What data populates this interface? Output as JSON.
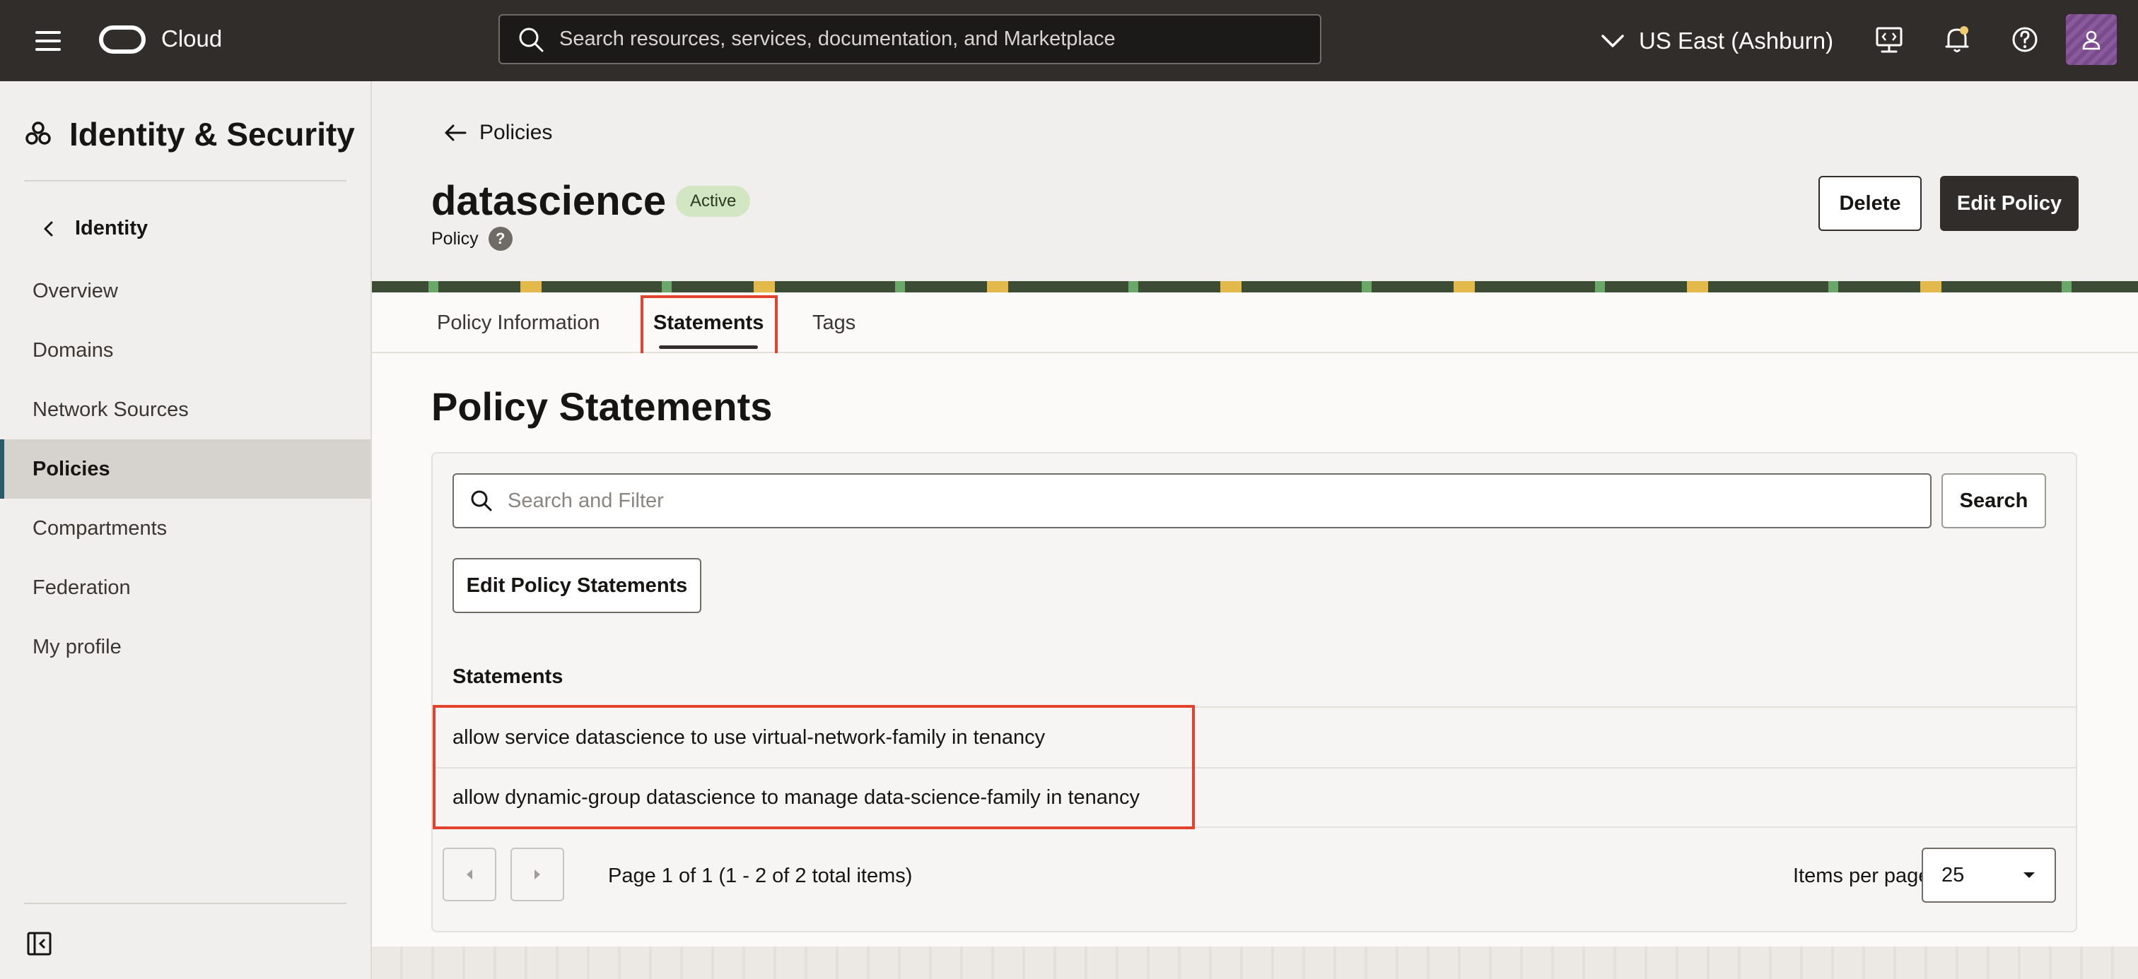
{
  "topbar": {
    "brand": "Cloud",
    "search_placeholder": "Search resources, services, documentation, and Marketplace",
    "region": "US East (Ashburn)",
    "icons": [
      "menu-icon",
      "oracle-logo-icon",
      "search-icon",
      "chevron-down-icon",
      "developer-tools-icon",
      "bell-icon",
      "help-icon",
      "user-avatar-icon"
    ]
  },
  "sidebar": {
    "title": "Identity & Security",
    "back_label": "Identity",
    "items": [
      {
        "label": "Overview",
        "active": false
      },
      {
        "label": "Domains",
        "active": false
      },
      {
        "label": "Network Sources",
        "active": false
      },
      {
        "label": "Policies",
        "active": true
      },
      {
        "label": "Compartments",
        "active": false
      },
      {
        "label": "Federation",
        "active": false
      },
      {
        "label": "My profile",
        "active": false
      }
    ]
  },
  "header": {
    "back_label": "Policies",
    "title": "datascience",
    "status": "Active",
    "subtitle": "Policy",
    "help_glyph": "?",
    "delete_label": "Delete",
    "edit_label": "Edit Policy"
  },
  "tabs": [
    {
      "label": "Policy Information",
      "active": false
    },
    {
      "label": "Statements",
      "active": true
    },
    {
      "label": "Tags",
      "active": false
    }
  ],
  "content": {
    "section_title": "Policy Statements",
    "filter_placeholder": "Search and Filter",
    "search_button": "Search",
    "edit_statements_button": "Edit Policy Statements",
    "statements_label": "Statements",
    "statements": [
      "allow service datascience to use virtual-network-family in tenancy",
      "allow dynamic-group datascience to manage data-science-family in tenancy"
    ],
    "pagination": {
      "page_info": "Page 1 of 1 (1 - 2 of 2 total items)",
      "items_per_page_label": "Items per page",
      "items_per_page_value": "25"
    }
  },
  "colors": {
    "topbar": "#312d2a",
    "status_badge": "#d3e6c3",
    "highlight": "#e2432f",
    "active_nav_border": "#2c5967"
  }
}
